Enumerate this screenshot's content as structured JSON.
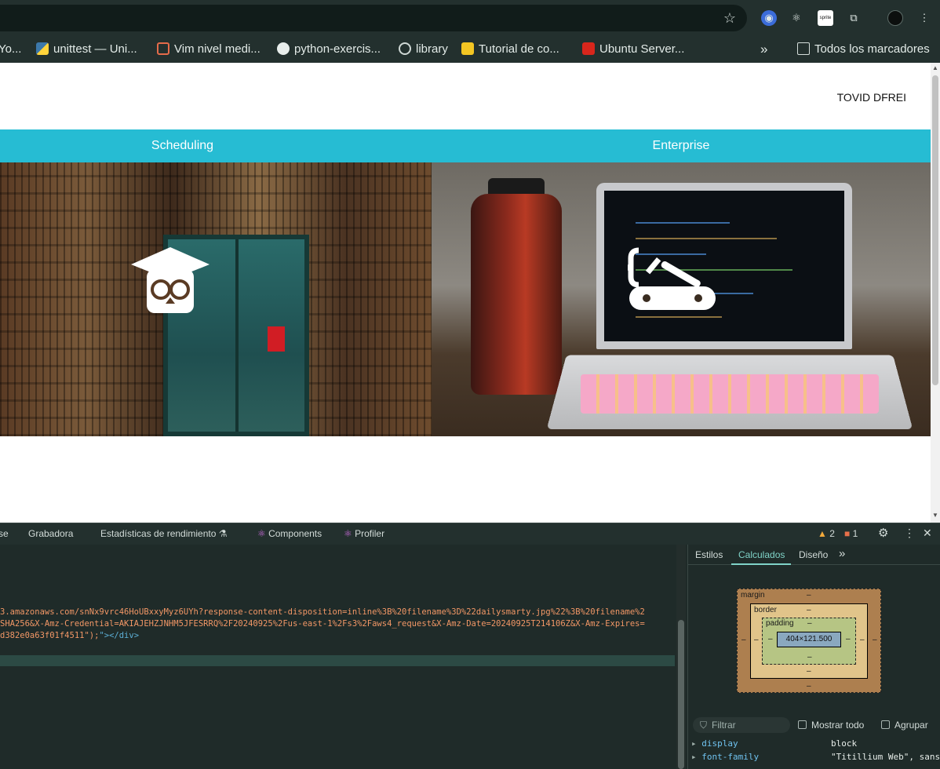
{
  "browser": {
    "bookmarks": [
      {
        "label": "Yo...",
        "icon": "youtube-icon"
      },
      {
        "label": "unittest — Uni...",
        "icon": "python-icon"
      },
      {
        "label": "Vim nivel medi...",
        "icon": "bookmark-icon"
      },
      {
        "label": "python-exercis...",
        "icon": "github-icon"
      },
      {
        "label": "library",
        "icon": "globe-icon"
      },
      {
        "label": "Tutorial de co...",
        "icon": "bulb-icon"
      },
      {
        "label": "Ubuntu Server...",
        "icon": "pdf-icon"
      }
    ],
    "more_label": "»",
    "all_bookmarks_label": "Todos los marcadores",
    "extension_sprite_label": "sprite"
  },
  "page": {
    "user_name": "TOVID DFREI",
    "tabs": [
      "Scheduling",
      "Enterprise"
    ]
  },
  "devtools": {
    "tabs": [
      {
        "label": "se"
      },
      {
        "label": "Grabadora"
      },
      {
        "label": "Estadísticas de rendimiento ⚗"
      },
      {
        "label": "Components"
      },
      {
        "label": "Profiler"
      }
    ],
    "warnings": "2",
    "errors": "1",
    "code_lines": [
      "3.amazonaws.com/snNx9vrc46HoUBxxyMyz6UYh?response-content-disposition=inline%3B%20filename%3D%22dailysmarty.jpg%22%3B%20filename%2",
      "SHA256&X-Amz-Credential=AKIAJEHZJNHM5JFESRRQ%2F20240925%2Fus-east-1%2Fs3%2Faws4_request&X-Amz-Date=20240925T214106Z&X-Amz-Expires=",
      "d382e0a63f01f4511\");"
    ],
    "code_tail": "\"></div>",
    "panel_tabs": [
      "Estilos",
      "Calculados",
      "Diseño"
    ],
    "panel_more": "»",
    "box_model": {
      "margin_label": "margin",
      "border_label": "border",
      "padding_label": "padding",
      "content_size": "404×121.500",
      "dash": "–"
    },
    "filter_placeholder": "Filtrar",
    "show_all_label": "Mostrar todo",
    "group_label": "Agrupar",
    "properties": [
      {
        "name": "display",
        "value": "block"
      },
      {
        "name": "font-family",
        "value": "\"Titillium Web\", sans"
      }
    ]
  },
  "colors": {
    "accent_tabs": "#26bcd3",
    "devtools_bg": "#1f2b29"
  }
}
